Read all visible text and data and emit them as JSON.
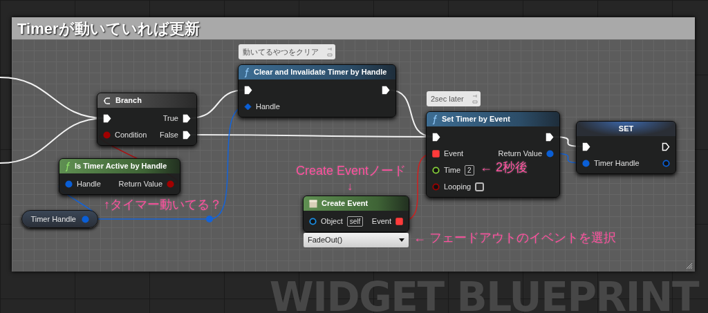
{
  "comment_box": {
    "title": "Timerが動いていれば更新"
  },
  "nodes": [
    {
      "kind": "branch",
      "title": "Branch",
      "inputs": [
        {
          "kind": "exec",
          "connected": true
        },
        {
          "kind": "bool",
          "label": "Condition",
          "connected": true
        }
      ],
      "outputs": [
        {
          "kind": "exec",
          "label": "True",
          "connected": true
        },
        {
          "kind": "exec",
          "label": "False",
          "connected": true
        }
      ]
    },
    {
      "kind": "function",
      "title": "Clear and Invalidate Timer by Handle",
      "comment": "動いてるやつをクリア",
      "inputs": [
        {
          "kind": "exec",
          "connected": true
        },
        {
          "kind": "struct_ref",
          "label": "Handle",
          "connected": true
        }
      ],
      "outputs": [
        {
          "kind": "exec",
          "connected": true
        }
      ]
    },
    {
      "kind": "pure",
      "title": "Is Timer Active by Handle",
      "inputs": [
        {
          "kind": "struct",
          "label": "Handle",
          "connected": true
        }
      ],
      "outputs": [
        {
          "kind": "bool",
          "label": "Return Value",
          "connected": true
        }
      ]
    },
    {
      "kind": "variable",
      "title": "Timer Handle",
      "outputs": [
        {
          "kind": "struct",
          "connected": true
        }
      ]
    },
    {
      "kind": "function",
      "title": "Set Timer by Event",
      "comment": "2sec later",
      "inputs": [
        {
          "kind": "exec",
          "connected": true
        },
        {
          "kind": "delegate",
          "label": "Event",
          "connected": true
        },
        {
          "kind": "float",
          "label": "Time",
          "connected": false,
          "value": "2"
        },
        {
          "kind": "bool",
          "label": "Looping",
          "connected": false,
          "checked": false
        }
      ],
      "outputs": [
        {
          "kind": "exec",
          "connected": true
        },
        {
          "kind": "struct",
          "label": "Return Value",
          "connected": true
        }
      ]
    },
    {
      "kind": "set",
      "title": "SET",
      "inputs": [
        {
          "kind": "exec",
          "connected": true
        },
        {
          "kind": "struct",
          "label": "Timer Handle",
          "connected": true
        }
      ],
      "outputs": [
        {
          "kind": "exec",
          "connected": false
        },
        {
          "kind": "struct",
          "connected": false
        }
      ]
    },
    {
      "kind": "create_event",
      "title": "Create Event",
      "inputs": [
        {
          "kind": "object",
          "label": "Object",
          "connected": false,
          "value": "self"
        }
      ],
      "outputs": [
        {
          "kind": "delegate",
          "label": "Event",
          "connected": true
        }
      ],
      "dropdown": "FadeOut()"
    }
  ],
  "annotations": [
    {
      "text": "Create Eventノード"
    },
    {
      "text": "↓"
    },
    {
      "text": "↑タイマー動いてる？"
    },
    {
      "text": "← 2秒後"
    },
    {
      "text": "← フェードアウトのイベントを選択"
    }
  ],
  "graph_label": "WIDGET BLUEPRINT"
}
